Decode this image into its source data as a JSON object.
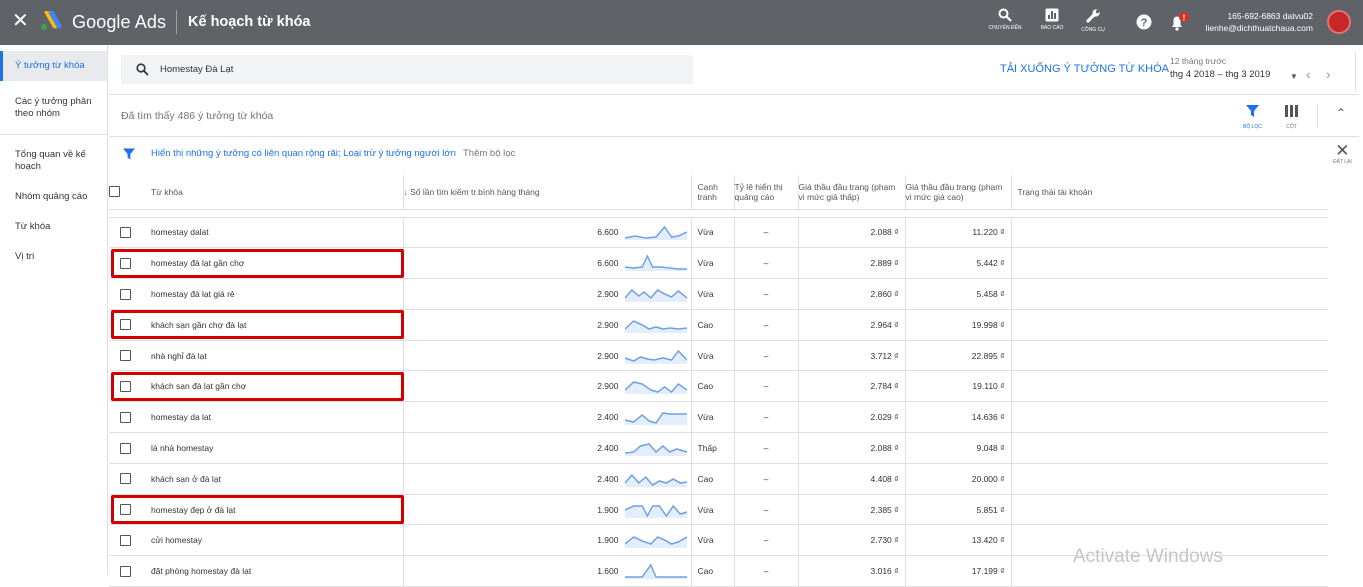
{
  "header": {
    "brand": "Google Ads",
    "page_title": "Kế hoạch từ khóa",
    "buttons": [
      {
        "label": "CHUYỂN ĐẾN",
        "icon": "search-icon"
      },
      {
        "label": "BÁO CÁO",
        "icon": "report-icon"
      },
      {
        "label": "CÔNG CỤ",
        "icon": "wrench-icon"
      }
    ],
    "account_id": "165-692-6863 datvu02",
    "account_email": "lienhe@dichthuatchaua.com"
  },
  "sidebar": {
    "items": [
      {
        "label": "Ý tưởng từ khóa",
        "active": true
      },
      {
        "label": "Các ý tưởng phân theo nhóm"
      },
      {
        "label": "Tổng quan về kế hoạch"
      },
      {
        "label": "Nhóm quảng cáo"
      },
      {
        "label": "Từ khóa"
      },
      {
        "label": "Vị trí"
      }
    ]
  },
  "search": {
    "query": "Homestay Đà Lạt"
  },
  "actions": {
    "download": "TẢI XUỐNG Ý TƯỞNG TỪ KHÓA",
    "range_caption": "12 tháng trước",
    "range": "thg 4 2018 – thg 3 2019"
  },
  "results": {
    "found_text": "Đã tìm thấy 486 ý tưởng từ khóa",
    "filter_label": "BỘ LỌC",
    "columns_label": "CỘT"
  },
  "filter": {
    "text": "Hiển thị những ý tưởng có liên quan rộng rãi; Loại trừ ý tưởng người lớn",
    "add": "Thêm bộ lọc",
    "reset": "ĐẶT LẠI"
  },
  "table": {
    "headers": {
      "keyword": "Từ khóa",
      "volume": "Số lần tìm kiếm tr.bình hàng tháng",
      "competition": "Cạnh tranh",
      "impression": "Tỷ lệ hiển thị quảng cáo",
      "bid_low": "Giá thầu đầu trang (phạm vi mức giá thấp)",
      "bid_high": "Giá thầu đầu trang (phạm vi mức giá cao)",
      "status": "Trạng thái tài khoản"
    },
    "rows": [
      {
        "keyword": "homestay dalat",
        "volume": "6.600",
        "competition": "Vừa",
        "impression": "–",
        "bid_low": "2.088 ₫",
        "bid_high": "11.220 ₫",
        "highlighted": false
      },
      {
        "keyword": "homestay đà lạt gần chợ",
        "volume": "6.600",
        "competition": "Vừa",
        "impression": "–",
        "bid_low": "2.889 ₫",
        "bid_high": "5.442 ₫",
        "highlighted": true
      },
      {
        "keyword": "homestay đà lạt giá rẻ",
        "volume": "2.900",
        "competition": "Vừa",
        "impression": "–",
        "bid_low": "2.860 ₫",
        "bid_high": "5.458 ₫",
        "highlighted": false
      },
      {
        "keyword": "khách sạn gần chợ đà lạt",
        "volume": "2.900",
        "competition": "Cao",
        "impression": "–",
        "bid_low": "2.964 ₫",
        "bid_high": "19.998 ₫",
        "highlighted": true
      },
      {
        "keyword": "nhà nghỉ đà lạt",
        "volume": "2.900",
        "competition": "Vừa",
        "impression": "–",
        "bid_low": "3.712 ₫",
        "bid_high": "22.895 ₫",
        "highlighted": false
      },
      {
        "keyword": "khách sạn đà lạt gần chợ",
        "volume": "2.900",
        "competition": "Cao",
        "impression": "–",
        "bid_low": "2.784 ₫",
        "bid_high": "19.110 ₫",
        "highlighted": true
      },
      {
        "keyword": "homestay da lat",
        "volume": "2.400",
        "competition": "Vừa",
        "impression": "–",
        "bid_low": "2.029 ₫",
        "bid_high": "14.636 ₫",
        "highlighted": false
      },
      {
        "keyword": "là nhà homestay",
        "volume": "2.400",
        "competition": "Thấp",
        "impression": "–",
        "bid_low": "2.088 ₫",
        "bid_high": "9.048 ₫",
        "highlighted": false
      },
      {
        "keyword": "khách sạn ở đà lạt",
        "volume": "2.400",
        "competition": "Cao",
        "impression": "–",
        "bid_low": "4.408 ₫",
        "bid_high": "20.000 ₫",
        "highlighted": false
      },
      {
        "keyword": "homestay đẹp ở đà lạt",
        "volume": "1.900",
        "competition": "Vừa",
        "impression": "–",
        "bid_low": "2.385 ₫",
        "bid_high": "5.851 ₫",
        "highlighted": true
      },
      {
        "keyword": "cửi homestay",
        "volume": "1.900",
        "competition": "Vừa",
        "impression": "–",
        "bid_low": "2.730 ₫",
        "bid_high": "13.420 ₫",
        "highlighted": false
      },
      {
        "keyword": "đặt phòng homestay đà lạt",
        "volume": "1.600",
        "competition": "Cao",
        "impression": "–",
        "bid_low": "3.016 ₫",
        "bid_high": "17.199 ₫",
        "highlighted": false
      }
    ]
  },
  "watermark": "Activate Windows",
  "colors": {
    "topbar": "#5f6368",
    "accent": "#1a73e8",
    "highlight": "#d20000"
  }
}
